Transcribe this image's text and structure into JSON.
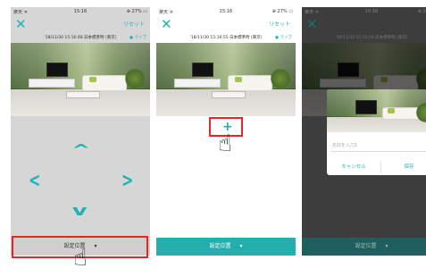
{
  "status": {
    "carrier": "楽天 ᯤ",
    "time": "15:16",
    "battery": "⊕ 27% ▭"
  },
  "topbar": {
    "close_glyph": "✕",
    "reset_label": "リセット"
  },
  "camera": {
    "timestamp_1": "'18/11/30 15:16:48 日本標準時 (東京)",
    "timestamp_2": "'18/11/30 15:16:55 日本標準時 (東京)",
    "timestamp_3": "'18/11/30 15:16:58 日本標準時 (東京)",
    "live_label": "● ライブ"
  },
  "arrows": {
    "up": "^",
    "down": "v",
    "left": "<",
    "right": ">"
  },
  "bottom": {
    "preset_label": "設定位置",
    "caret": "▾"
  },
  "add": {
    "plus": "+"
  },
  "dialog": {
    "input_placeholder": "名前を入力1",
    "cancel_label": "キャンセル",
    "save_label": "保存"
  },
  "icons": {
    "hand": "☝"
  },
  "colors": {
    "accent": "#1fb2b5",
    "highlight": "#e3262a"
  }
}
